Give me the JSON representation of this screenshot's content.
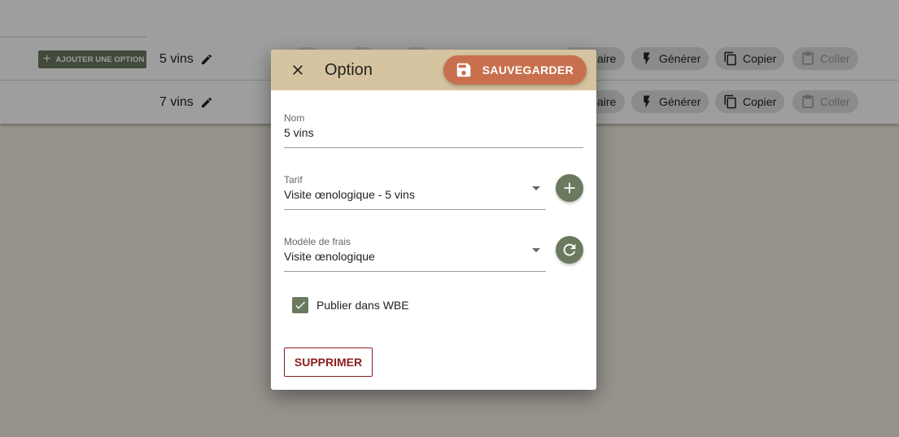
{
  "background": {
    "add_option_label": "AJOUTER UNE OPTION",
    "rows": [
      {
        "name": "5 vins"
      },
      {
        "name": "7 vins"
      }
    ],
    "actions": {
      "partial_label": "aire",
      "generate_label": "Générer",
      "copy_label": "Copier",
      "paste_label": "Coller"
    }
  },
  "dialog": {
    "title": "Option",
    "save_label": "SAUVEGARDER",
    "fields": {
      "name": {
        "label": "Nom",
        "value": "5 vins"
      },
      "tarif": {
        "label": "Tarif",
        "value": "Visite œnologique - 5 vins"
      },
      "fee_model": {
        "label": "Modèle de frais",
        "value": "Visite œnologique"
      }
    },
    "publish": {
      "label": "Publier dans WBE",
      "checked": true
    },
    "delete_label": "SUPPRIMER"
  },
  "colors": {
    "primary_olive": "#6b7a5f",
    "header_tan": "#d6c4a0",
    "save_orange": "#c8704e",
    "danger_red": "#8b1e1e"
  },
  "icons": [
    "close-icon",
    "save-icon",
    "add-icon",
    "refresh-icon",
    "check-icon",
    "pencil-icon",
    "flash-icon",
    "copy-icon",
    "clipboard-icon"
  ]
}
